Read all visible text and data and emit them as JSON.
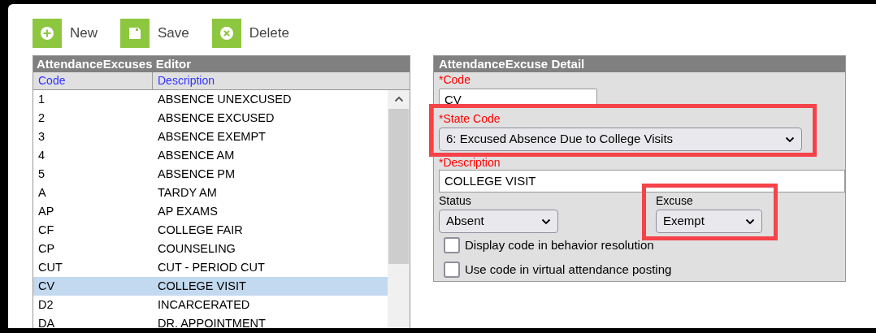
{
  "toolbar": [
    {
      "label": "New",
      "kind": "add"
    },
    {
      "label": "Save",
      "kind": "save"
    },
    {
      "label": "Delete",
      "kind": "delete"
    }
  ],
  "list": {
    "title": "AttendanceExcuses Editor",
    "columns": [
      "Code",
      "Description"
    ],
    "rows": [
      {
        "code": "1",
        "description": "ABSENCE UNEXCUSED",
        "selected": false
      },
      {
        "code": "2",
        "description": "ABSENCE EXCUSED",
        "selected": false
      },
      {
        "code": "3",
        "description": "ABSENCE EXEMPT",
        "selected": false
      },
      {
        "code": "4",
        "description": "ABSENCE AM",
        "selected": false
      },
      {
        "code": "5",
        "description": "ABSENCE PM",
        "selected": false
      },
      {
        "code": "A",
        "description": "TARDY AM",
        "selected": false
      },
      {
        "code": "AP",
        "description": "AP EXAMS",
        "selected": false
      },
      {
        "code": "CF",
        "description": "COLLEGE FAIR",
        "selected": false
      },
      {
        "code": "CP",
        "description": "COUNSELING",
        "selected": false
      },
      {
        "code": "CUT",
        "description": "CUT - PERIOD CUT",
        "selected": false
      },
      {
        "code": "CV",
        "description": "COLLEGE VISIT",
        "selected": true
      },
      {
        "code": "D2",
        "description": "INCARCERATED",
        "selected": false
      },
      {
        "code": "DA",
        "description": "DR. APPOINTMENT",
        "selected": false
      }
    ]
  },
  "detail": {
    "title": "AttendanceExcuse Detail",
    "code": {
      "label": "*Code",
      "value": "CV",
      "required": true
    },
    "state_code": {
      "label": "*State Code",
      "value": "6: Excused Absence Due to College Visits",
      "required": true,
      "highlighted": true
    },
    "description": {
      "label": "*Description",
      "value": "COLLEGE VISIT",
      "required": true
    },
    "status": {
      "label": "Status",
      "value": "Absent",
      "required": false
    },
    "excuse": {
      "label": "Excuse",
      "value": "Exempt",
      "required": false,
      "highlighted": true
    },
    "checkboxes": [
      {
        "label": "Display code in behavior resolution",
        "checked": false
      },
      {
        "label": "Use code in virtual attendance posting",
        "checked": false
      }
    ]
  }
}
